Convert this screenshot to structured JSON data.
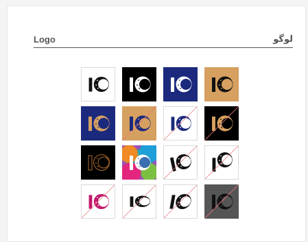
{
  "header": {
    "title_en": "Logo",
    "title_fa": "لوگو"
  },
  "logo_text": "IO",
  "tiles": [
    {
      "name": "logo-white-on-white",
      "bg": "#ffffff",
      "fg": "#111111",
      "moon": "#ffffff",
      "style": "solid",
      "border": true,
      "slash": false
    },
    {
      "name": "logo-white-on-black",
      "bg": "#000000",
      "fg": "#ffffff",
      "moon": "#000000",
      "style": "solid",
      "border": false,
      "slash": false
    },
    {
      "name": "logo-white-on-navy",
      "bg": "#1b2a7d",
      "fg": "#ffffff",
      "moon": "#1b2a7d",
      "style": "solid",
      "border": false,
      "slash": false
    },
    {
      "name": "logo-black-on-tan",
      "bg": "#d6a060",
      "fg": "#111111",
      "moon": "#d6a060",
      "style": "solid",
      "border": false,
      "slash": false
    },
    {
      "name": "logo-tan-on-navy",
      "bg": "#1b2a7d",
      "fg": "#d6a060",
      "moon": "#1b2a7d",
      "style": "solid",
      "border": false,
      "slash": false
    },
    {
      "name": "logo-navy-on-tan",
      "bg": "#d6a060",
      "fg": "#1b2a7d",
      "moon": "#d6a060",
      "style": "solid",
      "border": false,
      "slash": true
    },
    {
      "name": "logo-navy-on-white",
      "bg": "#ffffff",
      "fg": "#1b2a7d",
      "moon": "#ffffff",
      "style": "solid",
      "border": true,
      "slash": true
    },
    {
      "name": "logo-tan-on-black",
      "bg": "#000000",
      "fg": "#d6a060",
      "moon": "#000000",
      "style": "solid",
      "border": false,
      "slash": true
    },
    {
      "name": "logo-outline-on-black",
      "bg": "#000000",
      "fg": "#b06a2a",
      "moon": "#000000",
      "style": "outline",
      "border": false,
      "slash": false
    },
    {
      "name": "logo-white-on-multicolor",
      "bg": "multi",
      "fg": "#ffffff",
      "moon": "#3a6fb0",
      "style": "solid",
      "border": false,
      "slash": false
    },
    {
      "name": "logo-stretched-variant",
      "bg": "#ffffff",
      "fg": "#111111",
      "moon": "#ffffff",
      "style": "tilted",
      "border": true,
      "slash": true
    },
    {
      "name": "logo-misaligned-variant",
      "bg": "#ffffff",
      "fg": "#111111",
      "moon": "#ffffff",
      "style": "shifted",
      "border": true,
      "slash": true
    },
    {
      "name": "logo-magenta-on-white",
      "bg": "#ffffff",
      "fg": "#c2186b",
      "moon": "#ffffff",
      "style": "solid",
      "border": true,
      "slash": true
    },
    {
      "name": "logo-squashed-variant",
      "bg": "#ffffff",
      "fg": "#111111",
      "moon": "#ffffff",
      "style": "squash",
      "border": true,
      "slash": true
    },
    {
      "name": "logo-italic-variant",
      "bg": "#ffffff",
      "fg": "#111111",
      "moon": "#ffffff",
      "style": "italic",
      "border": true,
      "slash": true
    },
    {
      "name": "logo-black-on-gray",
      "bg": "#555555",
      "fg": "#111111",
      "moon": "#555555",
      "style": "solid",
      "border": false,
      "slash": true
    }
  ]
}
